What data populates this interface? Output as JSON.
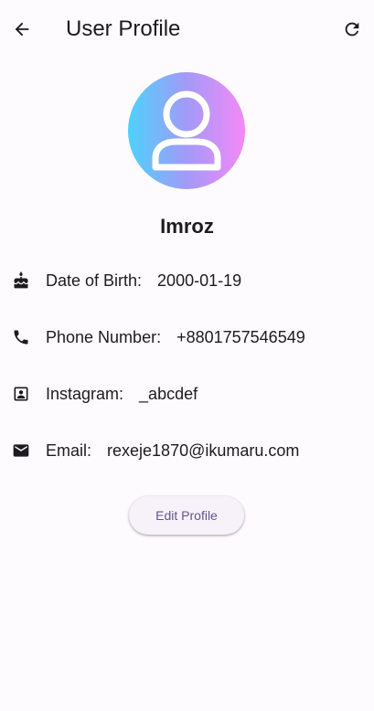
{
  "app_bar": {
    "title": "User Profile",
    "back_icon": "arrow-back-icon",
    "refresh_icon": "refresh-icon"
  },
  "profile": {
    "avatar_icon": "person-outline-icon",
    "avatar_gradient": [
      "#4dd2fb",
      "#a29af8",
      "#f589f6"
    ],
    "name": "Imroz"
  },
  "info": {
    "dob": {
      "icon": "cake-icon",
      "label": "Date of Birth:",
      "value": "2000-01-19"
    },
    "phone": {
      "icon": "phone-icon",
      "label": "Phone Number:",
      "value": "+8801757546549"
    },
    "instagram": {
      "icon": "contact-portrait-icon",
      "label": "Instagram:",
      "value": "_abcdef"
    },
    "email": {
      "icon": "mail-icon",
      "label": "Email:",
      "value": "rexeje1870@ikumaru.com"
    }
  },
  "actions": {
    "edit_label": "Edit Profile"
  },
  "colors": {
    "background": "#fefbfe",
    "accent_text": "#65558f",
    "button_bg": "#f7f1f9"
  }
}
